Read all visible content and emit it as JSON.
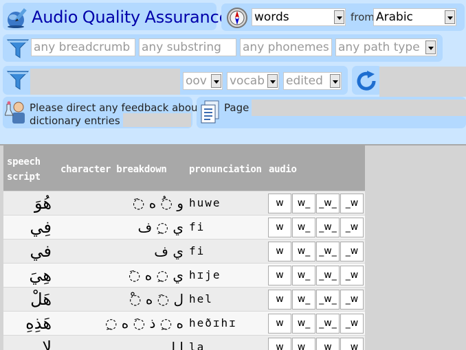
{
  "header": {
    "title_word1": "Audio",
    "title_word2": "Quality",
    "title_word3": "Assurance"
  },
  "mode": {
    "unit_value": "words",
    "from_label": "from",
    "language_value": "Arabic"
  },
  "filter1": {
    "breadcrumb_placeholder": "any breadcrumb",
    "substring_placeholder": "any substring",
    "phonemes_placeholder": "any phonemes",
    "path_type_value": "any path type"
  },
  "filter2": {
    "oov_value": "oov",
    "vocab_value": "vocab",
    "edited_value": "edited"
  },
  "feedback": {
    "text_line1": "Please direct any feedback about",
    "text_line2": "dictionary entries to"
  },
  "paging": {
    "page_label": "Page"
  },
  "icons": {
    "app": "globe-pencil-icon",
    "mode": "compass-icon",
    "filter": "funnel-icon",
    "refresh": "refresh-icon",
    "feedback": "person-flask-icon",
    "page": "document-icon"
  },
  "table": {
    "headers": {
      "speech_line1": "speech",
      "speech_line2": "script",
      "chars": "character breakdown",
      "pron": "pronunciation",
      "audio": "audio"
    },
    "audio_buttons": [
      "w",
      "w_",
      "_w_",
      "_w"
    ],
    "rows": [
      {
        "word": "هُوَ",
        "chars": "◌َ و ◌ُ ه",
        "pron": "huwe"
      },
      {
        "word": "فِي",
        "chars": "ي ◌ِ ف",
        "pron": "fi"
      },
      {
        "word": "في",
        "chars": "ي ف",
        "pron": "fi"
      },
      {
        "word": "هِيَ",
        "chars": "◌َ ي ◌ِ ه",
        "pron": "hɪje"
      },
      {
        "word": "هَلْ",
        "chars": "◌ْ ل ◌َ ه",
        "pron": "hel"
      },
      {
        "word": "هَذِهِ",
        "chars": "◌ِ ه ◌ِ ذ ◌َ ه",
        "pron": "heðɪhɪ"
      },
      {
        "word": "لا",
        "chars": "ا ل",
        "pron": "la"
      }
    ]
  },
  "colors": {
    "background": "#cce6ff",
    "panel": "#b3d9ff",
    "title": "#0000aa",
    "table_header": "#a8a8a8"
  }
}
